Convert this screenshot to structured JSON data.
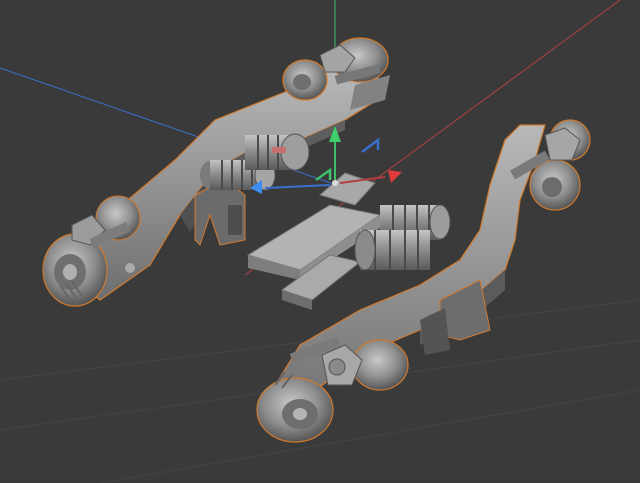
{
  "viewport": {
    "background": "#3a3a3a",
    "grid_line_color": "#4a4a4a",
    "axis_x_color": "#b04040",
    "axis_y_color": "#3fbf6a",
    "axis_z_color": "#3a6fd0",
    "selection_outline_color": "#d07a30",
    "model_base_color": "#9a9a9a",
    "model_shadow_color": "#5a5a5a",
    "model_highlight_color": "#c8c8c8"
  },
  "gizmo": {
    "x_handle": "red-arrow-icon",
    "y_handle": "green-arrow-icon",
    "z_handle": "blue-arrow-icon",
    "plane_handles": [
      "blue-plane-handle-icon",
      "green-plane-handle-icon"
    ]
  },
  "scene_objects": [
    {
      "name": "bogie-left-arm"
    },
    {
      "name": "bogie-right-arm"
    },
    {
      "name": "center-pivot-block"
    },
    {
      "name": "spring-damper-left"
    },
    {
      "name": "spring-damper-right"
    },
    {
      "name": "wheel-assembly-front-left"
    },
    {
      "name": "wheel-assembly-rear-left"
    },
    {
      "name": "wheel-assembly-front-right"
    },
    {
      "name": "wheel-assembly-rear-right"
    }
  ]
}
